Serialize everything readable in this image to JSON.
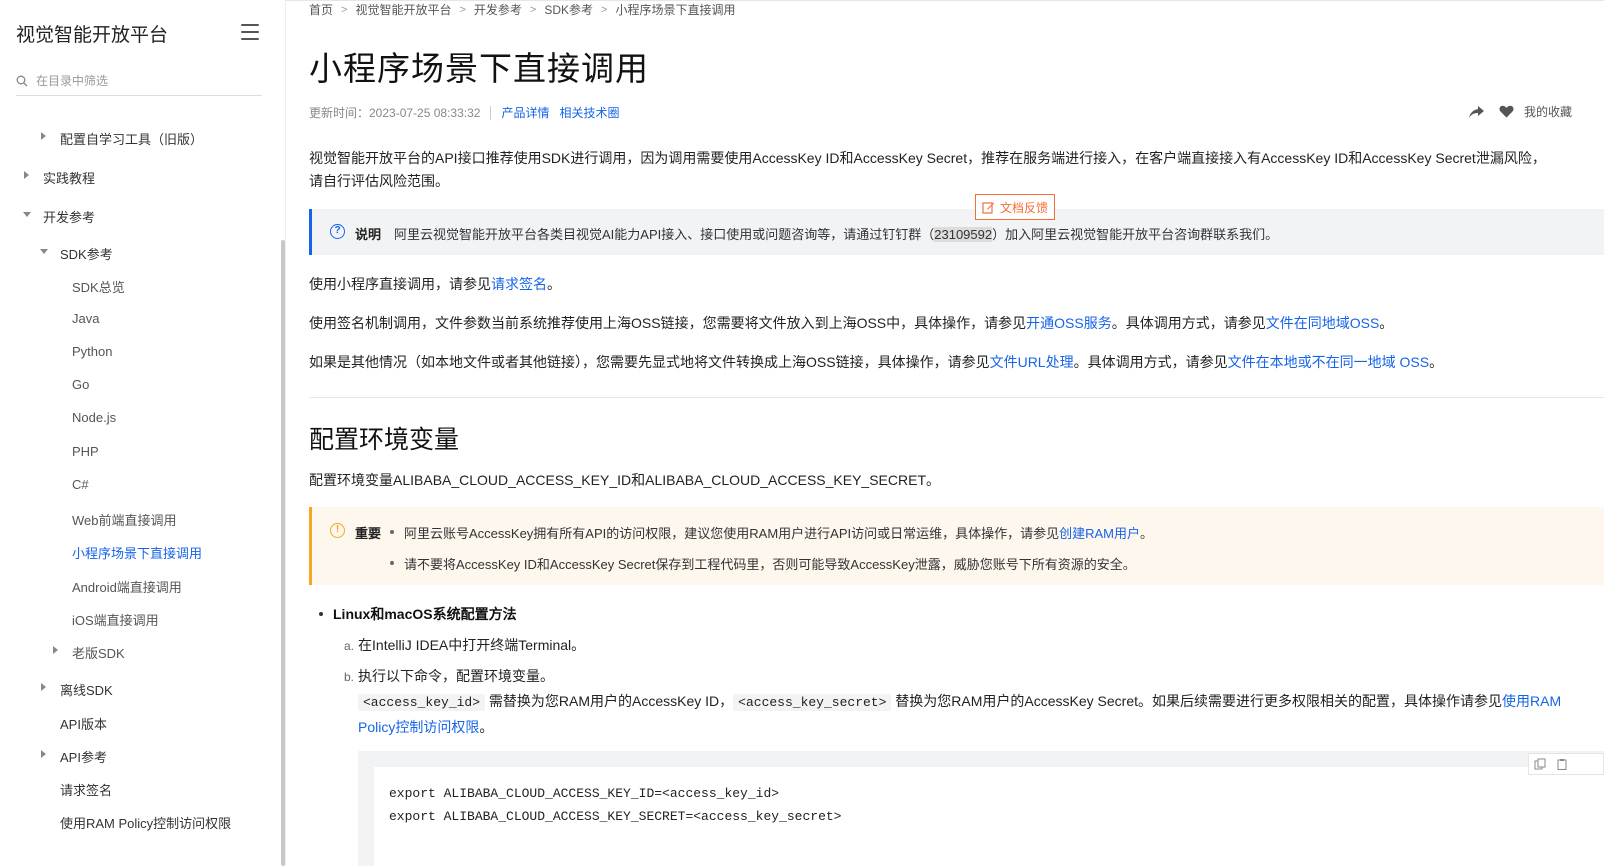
{
  "sidebar": {
    "title": "视觉智能开放平台",
    "search_placeholder": "在目录中筛选",
    "items": [
      {
        "label": "配置自学习工具（旧版）"
      },
      {
        "label": "实践教程"
      },
      {
        "label": "开发参考"
      },
      {
        "label": "SDK参考"
      },
      {
        "label": "SDK总览"
      },
      {
        "label": "Java"
      },
      {
        "label": "Python"
      },
      {
        "label": "Go"
      },
      {
        "label": "Node.js"
      },
      {
        "label": "PHP"
      },
      {
        "label": "C#"
      },
      {
        "label": "Web前端直接调用"
      },
      {
        "label": "小程序场景下直接调用"
      },
      {
        "label": "Android端直接调用"
      },
      {
        "label": "iOS端直接调用"
      },
      {
        "label": "老版SDK"
      },
      {
        "label": "离线SDK"
      },
      {
        "label": "API版本"
      },
      {
        "label": "API参考"
      },
      {
        "label": "请求签名"
      },
      {
        "label": "使用RAM Policy控制访问权限"
      }
    ]
  },
  "breadcrumb": [
    "首页",
    "视觉智能开放平台",
    "开发参考",
    "SDK参考",
    "小程序场景下直接调用"
  ],
  "page": {
    "title": "小程序场景下直接调用",
    "updated": "更新时间：2023-07-25 08:33:32",
    "meta_links": [
      "产品详情",
      "相关技术圈"
    ],
    "favorite_label": "我的收藏"
  },
  "intro": {
    "line1": "视觉智能开放平台的API接口推荐使用SDK进行调用，因为调用需要使用AccessKey ID和AccessKey Secret，推荐在服务端进行接入，在客户端直接接入有AccessKey ID和AccessKey Secret泄漏风险，",
    "line2": "请自行评估风险范围。"
  },
  "feedback_label": "文档反馈",
  "note": {
    "label": "说明",
    "text_before": "阿里云视觉智能开放平台各类目视觉AI能力API接入、接口使用或问题咨询等，请通过钉钉群（",
    "group_id": "23109592",
    "text_after": "）加入阿里云视觉智能开放平台咨询群联系我们。"
  },
  "p1": {
    "before": "使用小程序直接调用，请参见",
    "link": "请求签名",
    "after": "。"
  },
  "p2": {
    "before": "使用签名机制调用，文件参数当前系统推荐使用上海OSS链接，您需要将文件放入到上海OSS中，具体操作，请参见",
    "link1": "开通OSS服务",
    "mid": "。具体调用方式，请参见",
    "link2": "文件在同地域OSS",
    "after": "。"
  },
  "p3": {
    "before": "如果是其他情况（如本地文件或者其他链接），您需要先显式地将文件转换成上海OSS链接，具体操作，请参见",
    "link1": "文件URL处理",
    "mid": "。具体调用方式，请参见",
    "link2": "文件在本地或不在同一地域 OSS",
    "after": "。"
  },
  "section": {
    "title": "配置环境变量",
    "desc": "配置环境变量ALIBABA_CLOUD_ACCESS_KEY_ID和ALIBABA_CLOUD_ACCESS_KEY_SECRET。"
  },
  "warning": {
    "label": "重要",
    "item1_before": "阿里云账号AccessKey拥有所有API的访问权限，建议您使用RAM用户进行API访问或日常运维，具体操作，请参见",
    "item1_link": "创建RAM用户",
    "item1_after": "。",
    "item2": "请不要将AccessKey ID和AccessKey Secret保存到工程代码里，否则可能导致AccessKey泄露，威胁您账号下所有资源的安全。"
  },
  "steps": {
    "bullet": "Linux和macOS系统配置方法",
    "a_marker": "a.",
    "a_text": "在IntelliJ IDEA中打开终端Terminal。",
    "b_marker": "b.",
    "b_text": "执行以下命令，配置环境变量。",
    "b_code1": "<access_key_id>",
    "b_text2": "需替换为您RAM用户的AccessKey ID，",
    "b_code2": "<access_key_secret>",
    "b_text3": "替换为您RAM用户的AccessKey Secret。如果后续需要进行更多权限相关的配置，具体操作请参见",
    "b_link_part1": "使用RAM",
    "b_link_part2": "Policy控制访问权限",
    "b_after": "。"
  },
  "code": [
    "export ALIBABA_CLOUD_ACCESS_KEY_ID=<access_key_id>",
    "export ALIBABA_CLOUD_ACCESS_KEY_SECRET=<access_key_secret>"
  ]
}
